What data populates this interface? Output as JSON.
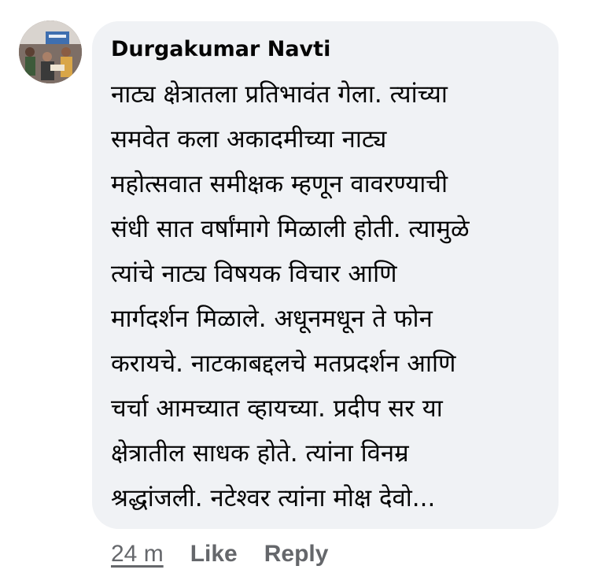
{
  "comment": {
    "author": "Durgakumar Navti",
    "lines": [
      "नाट्य क्षेत्रातला प्रतिभावंत गेला. त्यांच्या",
      "समवेत कला अकादमीच्या नाट्य",
      "महोत्सवात समीक्षक म्हणून वावरण्याची",
      "संधी सात वर्षांमागे मिळाली होती. त्यामुळे",
      "त्यांचे नाट्य विषयक विचार आणि",
      "मार्गदर्शन मिळाले. अधूनमधून ते फोन",
      "करायचे. नाटकाबद्दलचे मतप्रदर्शन आणि",
      "चर्चा आमच्यात व्हायच्या. प्रदीप सर या",
      "क्षेत्रातील साधक होते. त्यांना विनम्र",
      "श्रद्धांजली. नटेश्वर त्यांना मोक्ष देवो..."
    ]
  },
  "actions": {
    "timestamp": "24 m",
    "like_label": "Like",
    "reply_label": "Reply"
  },
  "colors": {
    "bubble_background": "#f0f2f5",
    "text": "#050505",
    "secondary_text": "#65676b"
  }
}
